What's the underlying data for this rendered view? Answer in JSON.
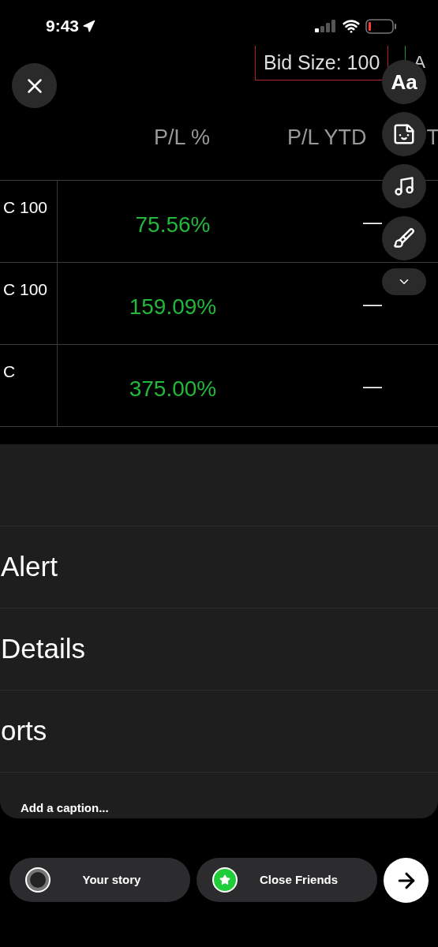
{
  "status_bar": {
    "time": "9:43"
  },
  "story": {
    "bid_size": "Bid Size: 100",
    "cut_label": "A",
    "columns": [
      "P/L %",
      "P/L YTD",
      "T"
    ],
    "rows": [
      {
        "contract": "C 100",
        "pl_percent": "75.56%",
        "pl_ytd": "—"
      },
      {
        "contract": "C 100",
        "pl_percent": "159.09%",
        "pl_ytd": "—"
      },
      {
        "contract": "C",
        "pl_percent": "375.00%",
        "pl_ytd": "—"
      }
    ],
    "menu_items": [
      "Alert",
      "Details",
      "orts"
    ]
  },
  "tools": [
    {
      "kind": "text",
      "label": "Aa"
    },
    {
      "kind": "sticker"
    },
    {
      "kind": "music"
    },
    {
      "kind": "effects"
    },
    {
      "kind": "more"
    }
  ],
  "caption": {
    "placeholder": "Add a caption..."
  },
  "share_buttons": [
    {
      "kind": "story",
      "label": "Your story"
    },
    {
      "kind": "close_friends",
      "label": "Close Friends"
    }
  ]
}
